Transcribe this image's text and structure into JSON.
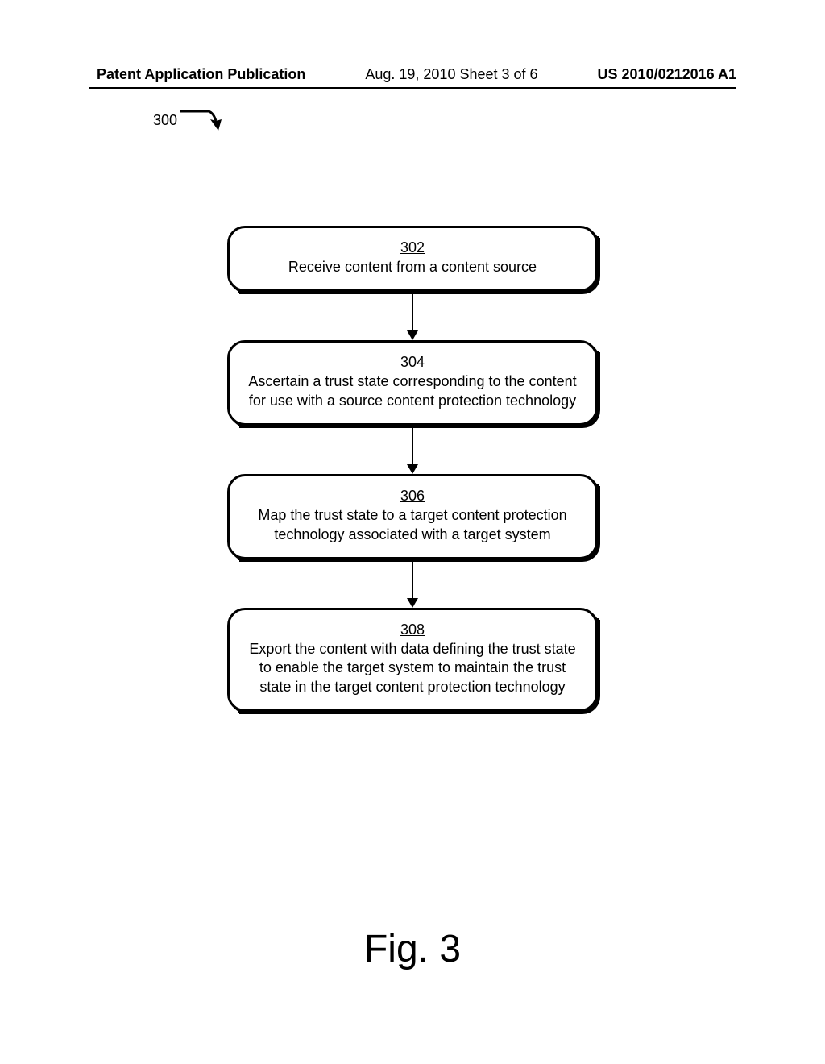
{
  "header": {
    "left": "Patent Application Publication",
    "center": "Aug. 19, 2010  Sheet 3 of 6",
    "right": "US 2010/0212016 A1"
  },
  "reference_label": "300",
  "steps": [
    {
      "number": "302",
      "text": "Receive content from a content source"
    },
    {
      "number": "304",
      "text": "Ascertain a trust state corresponding to the content for use with a source content protection technology"
    },
    {
      "number": "306",
      "text": "Map the trust state to a target content protection technology associated with a target system"
    },
    {
      "number": "308",
      "text": "Export the content with data defining the trust state to enable the target system to maintain the trust state in the target content protection technology"
    }
  ],
  "figure_label": "Fig. 3"
}
